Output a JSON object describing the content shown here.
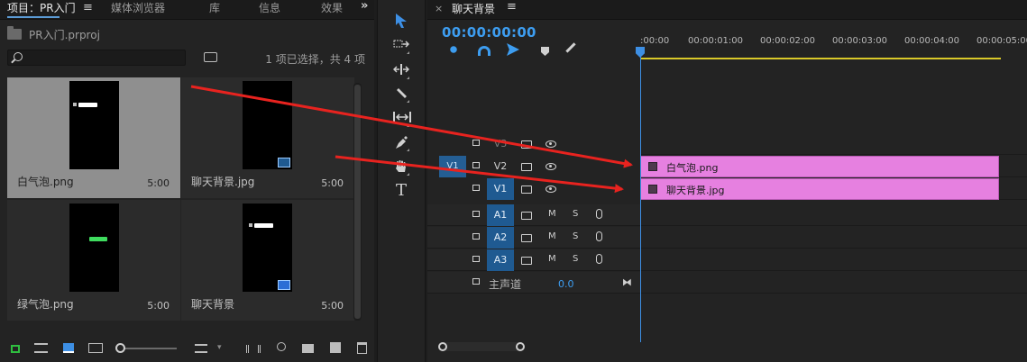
{
  "project_panel": {
    "tabs": [
      "项目：PR入门",
      "媒体浏览器",
      "库",
      "信息",
      "效果"
    ],
    "tab_menu_glyph": "≡",
    "overflow_glyph": "»",
    "project_file": "PR入门.prproj",
    "search": {
      "value": "",
      "placeholder": ""
    },
    "selection_status": "1 项已选择，共 4 项",
    "items": [
      {
        "name": "白气泡.png",
        "duration": "5:00",
        "selected": true
      },
      {
        "name": "聊天背景.jpg",
        "duration": "5:00",
        "selected": false
      },
      {
        "name": "绿气泡.png",
        "duration": "5:00",
        "selected": false
      },
      {
        "name": "聊天背景",
        "duration": "5:00",
        "selected": false
      }
    ]
  },
  "tools": [
    "selection-tool",
    "track-select-tool",
    "ripple-edit-tool",
    "razor-tool",
    "slip-tool",
    "pen-tool",
    "hand-tool",
    "type-tool"
  ],
  "type_tool_glyph": "T",
  "timeline": {
    "close_glyph": "×",
    "title": "聊天背景",
    "menu_glyph": "≡",
    "timecode": "00:00:00:00",
    "ruler_labels": [
      ":00:00",
      "00:00:01:00",
      "00:00:02:00",
      "00:00:03:00",
      "00:00:04:00",
      "00:00:05:00"
    ],
    "source_patch": "V1",
    "video_tracks": [
      {
        "label": "V3",
        "highlighted": false,
        "clip": null
      },
      {
        "label": "V2",
        "highlighted": false,
        "clip": "白气泡.png"
      },
      {
        "label": "V1",
        "highlighted": true,
        "clip": "聊天背景.jpg"
      }
    ],
    "audio_tracks": [
      {
        "label": "A1",
        "m": "M",
        "s": "S"
      },
      {
        "label": "A2",
        "m": "M",
        "s": "S"
      },
      {
        "label": "A3",
        "m": "M",
        "s": "S"
      }
    ],
    "master": {
      "label": "主声道",
      "value": "0.0",
      "end_glyph": "⧓"
    }
  },
  "colors": {
    "accent_blue": "#3d8fe4",
    "clip_pink": "#e680e0",
    "annotation_arrow": "#e8231f",
    "work_area_yellow": "#d9c829"
  }
}
